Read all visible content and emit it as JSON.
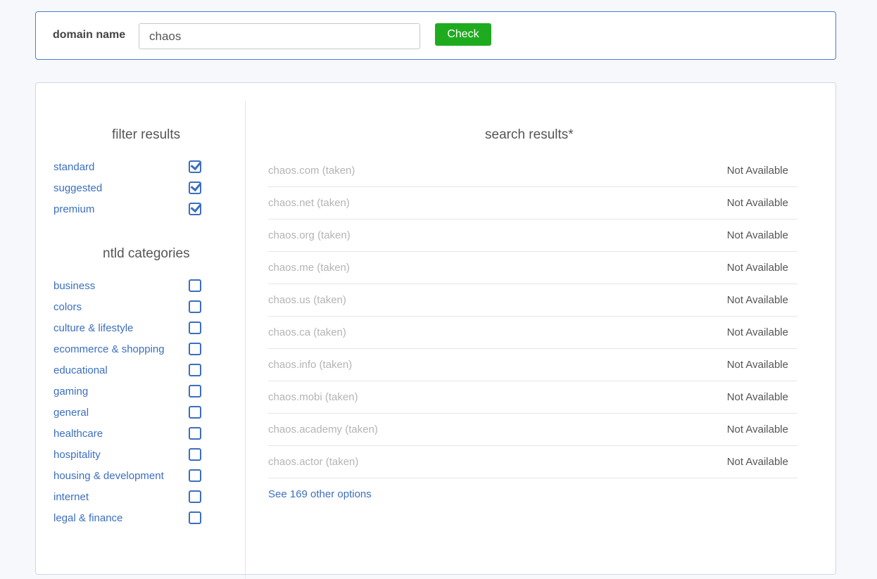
{
  "search": {
    "label": "domain name",
    "value": "chaos",
    "button_label": "Check"
  },
  "filters": {
    "title": "filter results",
    "items": [
      {
        "label": "standard",
        "checked": true
      },
      {
        "label": "suggested",
        "checked": true
      },
      {
        "label": "premium",
        "checked": true
      }
    ]
  },
  "categories": {
    "title": "ntld categories",
    "items": [
      {
        "label": "business",
        "checked": false
      },
      {
        "label": "colors",
        "checked": false
      },
      {
        "label": "culture & lifestyle",
        "checked": false
      },
      {
        "label": "ecommerce & shopping",
        "checked": false
      },
      {
        "label": "educational",
        "checked": false
      },
      {
        "label": "gaming",
        "checked": false
      },
      {
        "label": "general",
        "checked": false
      },
      {
        "label": "healthcare",
        "checked": false
      },
      {
        "label": "hospitality",
        "checked": false
      },
      {
        "label": "housing & development",
        "checked": false
      },
      {
        "label": "internet",
        "checked": false
      },
      {
        "label": "legal & finance",
        "checked": false
      }
    ]
  },
  "results": {
    "title": "search results*",
    "rows": [
      {
        "domain": "chaos.com (taken)",
        "status": "Not Available"
      },
      {
        "domain": "chaos.net (taken)",
        "status": "Not Available"
      },
      {
        "domain": "chaos.org (taken)",
        "status": "Not Available"
      },
      {
        "domain": "chaos.me (taken)",
        "status": "Not Available"
      },
      {
        "domain": "chaos.us (taken)",
        "status": "Not Available"
      },
      {
        "domain": "chaos.ca (taken)",
        "status": "Not Available"
      },
      {
        "domain": "chaos.info (taken)",
        "status": "Not Available"
      },
      {
        "domain": "chaos.mobi (taken)",
        "status": "Not Available"
      },
      {
        "domain": "chaos.academy (taken)",
        "status": "Not Available"
      },
      {
        "domain": "chaos.actor (taken)",
        "status": "Not Available"
      }
    ],
    "more_link": "See 169 other options"
  },
  "colors": {
    "accent": "#3c6fbd",
    "button_green": "#1fab1f",
    "taken_text": "#b4b4b4"
  }
}
